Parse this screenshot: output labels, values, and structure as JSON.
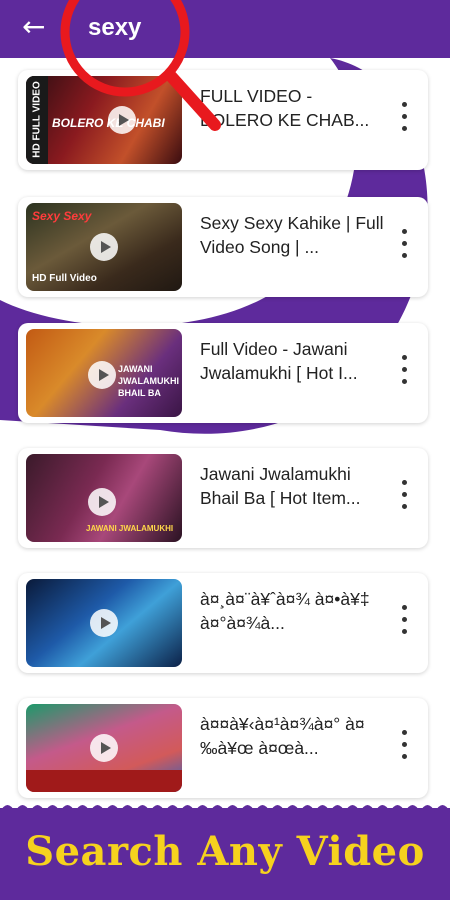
{
  "header": {
    "back_icon": "arrow-left-icon",
    "search_query": "sexy",
    "overlay_icon": "magnifier-icon",
    "overlay_color": "#e8191e"
  },
  "colors": {
    "brand_purple": "#5e2a9c",
    "banner_text": "#f6d21e"
  },
  "results": [
    {
      "title": "FULL VIDEO - BOLERO KE CHAB...",
      "thumb_caption": "BOLERO KE CHABI",
      "thumb_side": "HD FULL VIDEO"
    },
    {
      "title": "Sexy Sexy Kahike | Full Video Song | ...",
      "thumb_caption": "Sexy Sexy",
      "thumb_side": "HD Full Video"
    },
    {
      "title": "Full Video - Jawani Jwalamukhi [ Hot I...",
      "thumb_caption": "JAWANI JWALAMUKHI BHAIL BA",
      "thumb_side": ""
    },
    {
      "title": "Jawani Jwalamukhi Bhail Ba [ Hot Item...",
      "thumb_caption": "JAWANI JWALAMUKHI",
      "thumb_side": ""
    },
    {
      "title": "à¤¸à¤¨à¥ˆà¤¾ à¤•à¥‡ à¤°à¤¾à...",
      "thumb_caption": "",
      "thumb_side": ""
    },
    {
      "title": "à¤¤à¥‹à¤¹à¤¾à¤° à¤‰à¥œ à¤œà...",
      "thumb_caption": "",
      "thumb_side": ""
    }
  ],
  "banner": {
    "text": "Search Any Video"
  }
}
